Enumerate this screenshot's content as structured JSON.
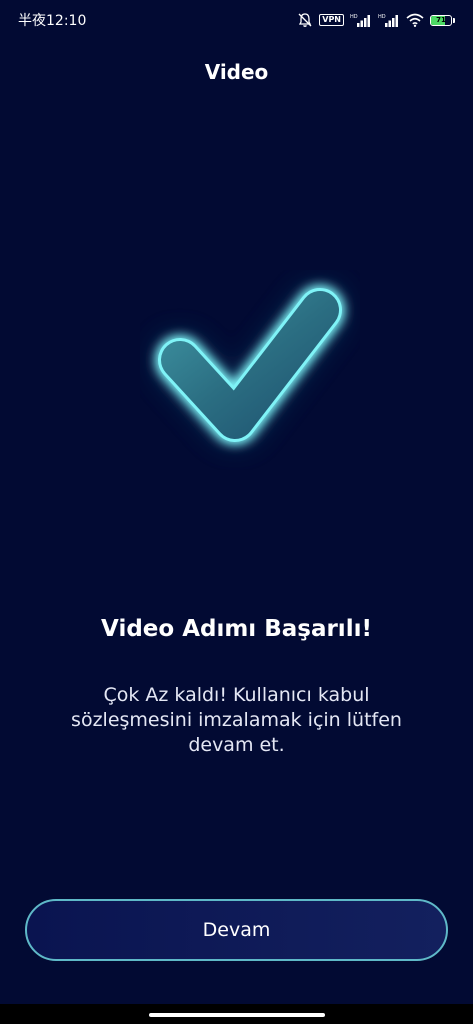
{
  "status_bar": {
    "time": "半夜12:10",
    "vpn": "VPN",
    "battery_percent": 71,
    "battery_label": "71",
    "icons": [
      "bell-muted-icon",
      "vpn-icon",
      "signal-hd-icon",
      "signal-hd-icon",
      "wifi-icon",
      "battery-icon"
    ]
  },
  "header": {
    "title": "Video"
  },
  "main": {
    "headline": "Video Adımı Başarılı!",
    "message": "Çok Az kaldı! Kullanıcı kabul sözleşmesini imzalamak için lütfen devam et.",
    "icon": "checkmark-icon"
  },
  "footer": {
    "continue_label": "Devam"
  },
  "colors": {
    "background": "#020a33",
    "accent": "#4fe3ee",
    "button_border": "#5fb9c8"
  }
}
